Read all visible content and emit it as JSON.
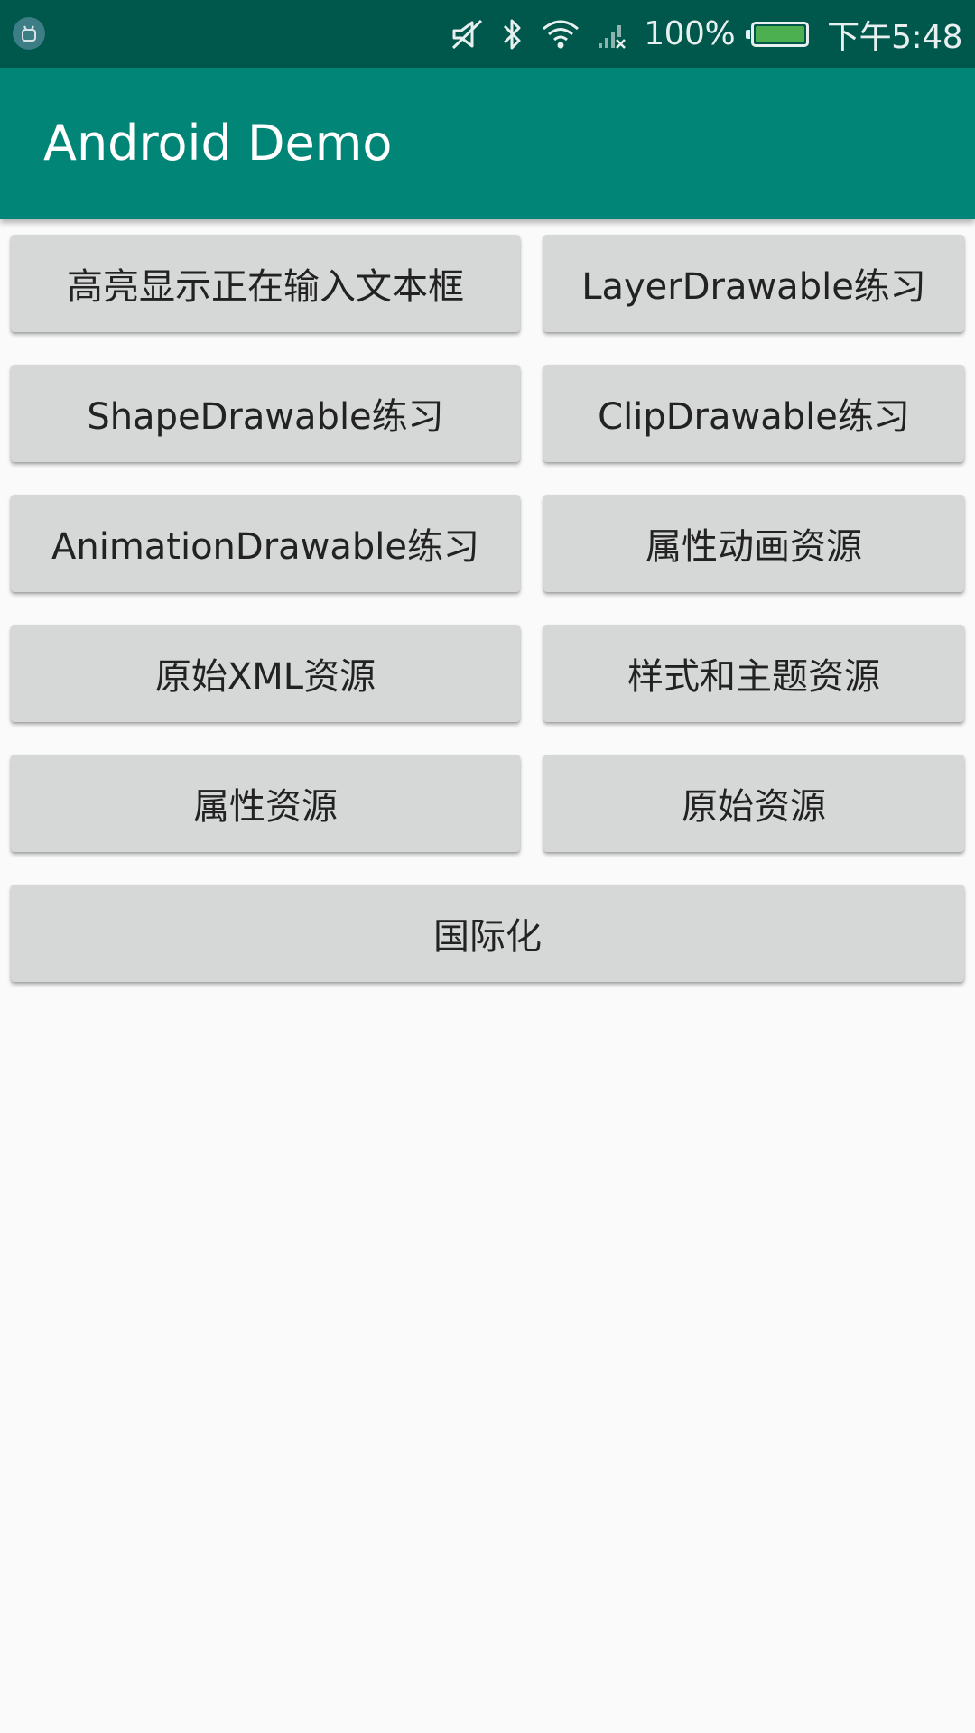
{
  "status_bar": {
    "battery_text": "100%",
    "time": "下午5:48",
    "battery_level": 1.0,
    "battery_color": "#4caf50",
    "icons": [
      "android-debug-icon",
      "mute-icon",
      "bluetooth-icon",
      "wifi-icon",
      "signal-icon",
      "battery-icon"
    ]
  },
  "app_bar": {
    "title": "Android Demo",
    "color": "#008577"
  },
  "buttons": [
    {
      "label": "高亮显示正在输入文本框"
    },
    {
      "label": "LayerDrawable练习"
    },
    {
      "label": "ShapeDrawable练习"
    },
    {
      "label": "ClipDrawable练习"
    },
    {
      "label": "AnimationDrawable练习"
    },
    {
      "label": "属性动画资源"
    },
    {
      "label": "原始XML资源"
    },
    {
      "label": "样式和主题资源"
    },
    {
      "label": "属性资源"
    },
    {
      "label": "原始资源"
    },
    {
      "label": "国际化"
    }
  ]
}
